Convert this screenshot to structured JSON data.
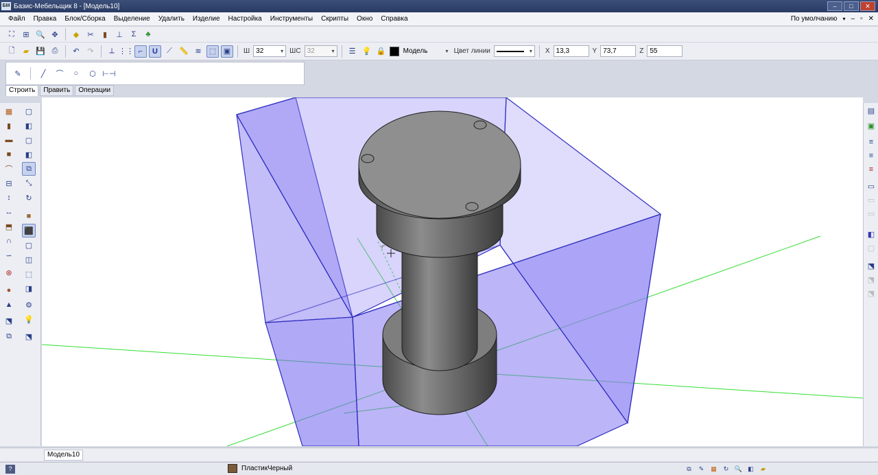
{
  "window": {
    "title": "Базис-Мебельщик 8 - [Модель10]",
    "app_icon_text": "БМ",
    "controls": {
      "minimize": "–",
      "maximize": "□",
      "close": "✕"
    }
  },
  "menu": {
    "items": [
      "Файл",
      "Правка",
      "Блок/Сборка",
      "Выделение",
      "Удалить",
      "Изделие",
      "Настройка",
      "Инструменты",
      "Скрипты",
      "Окно",
      "Справка"
    ],
    "right_label": "По умолчанию",
    "right_controls": [
      "–",
      "▫",
      "✕"
    ]
  },
  "properties_bar": {
    "width_label": "Ш",
    "width_value": "32",
    "width2_label": "ШС",
    "width2_value": "32",
    "layer_value": "Модель",
    "line_color_label": "Цвет линии",
    "x_label": "X",
    "x_value": "13,3",
    "y_label": "Y",
    "y_value": "73,7",
    "z_label": "Z",
    "z_value": "55"
  },
  "panel": {
    "tabs": [
      "Строить",
      "Править",
      "Операции"
    ],
    "active_tab": "Строить"
  },
  "document": {
    "tab_label": "Модель10"
  },
  "status": {
    "help_icon": "?",
    "material_name": "ПластикЧерный"
  },
  "colors": {
    "box_fill": "#7a6cf0",
    "box_edge": "#2d2dbf",
    "axis_green": "#33dd33",
    "part_gray": "#8a8a8a"
  }
}
